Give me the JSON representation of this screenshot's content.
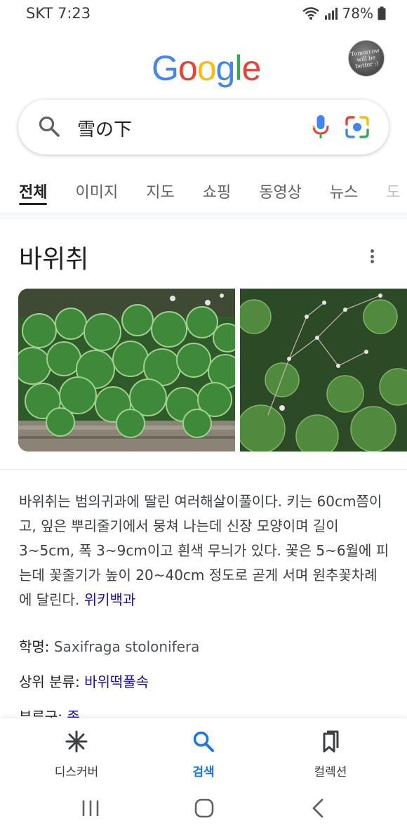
{
  "status_bar": {
    "carrier_time": "SKT 7:23",
    "battery": "78%"
  },
  "header": {
    "logo_letters": [
      {
        "ch": "G",
        "color": "#4285F4"
      },
      {
        "ch": "o",
        "color": "#EA4335"
      },
      {
        "ch": "o",
        "color": "#FBBC05"
      },
      {
        "ch": "g",
        "color": "#4285F4"
      },
      {
        "ch": "l",
        "color": "#34A853"
      },
      {
        "ch": "e",
        "color": "#EA4335"
      }
    ],
    "avatar_text": "Tomorrow\nwill be\nbetter :)"
  },
  "search": {
    "query": "雪の下"
  },
  "tabs": [
    {
      "label": "전체",
      "active": true
    },
    {
      "label": "이미지",
      "active": false
    },
    {
      "label": "지도",
      "active": false
    },
    {
      "label": "쇼핑",
      "active": false
    },
    {
      "label": "동영상",
      "active": false
    },
    {
      "label": "뉴스",
      "active": false
    },
    {
      "label": "도",
      "active": false
    }
  ],
  "knowledge_panel": {
    "title": "바위취",
    "description": "바위취는 범의귀과에 딸린 여러해살이풀이다. 키는 60cm쯤이고, 잎은 뿌리줄기에서 뭉쳐 나는데 신장 모양이며 길이 3~5cm, 폭 3~9cm이고 흰색 무늬가 있다. 꽃은 5~6월에 피는데 꽃줄기가 높이 20~40cm 정도로 곧게 서며 원추꽃차례에 달린다.",
    "source_link": "위키백과",
    "facts": [
      {
        "label": "학명:",
        "value": "Saxifraga stolonifera",
        "is_link": false
      },
      {
        "label": "상위 분류:",
        "value": "바위떡풀속",
        "is_link": true
      },
      {
        "label": "부류군:",
        "value": "종",
        "is_link": true
      }
    ]
  },
  "bottom_nav": {
    "discover": "디스커버",
    "search": "검색",
    "collections": "컬렉션"
  },
  "colors": {
    "accent": "#1a73e8",
    "link": "#1a0dab"
  }
}
